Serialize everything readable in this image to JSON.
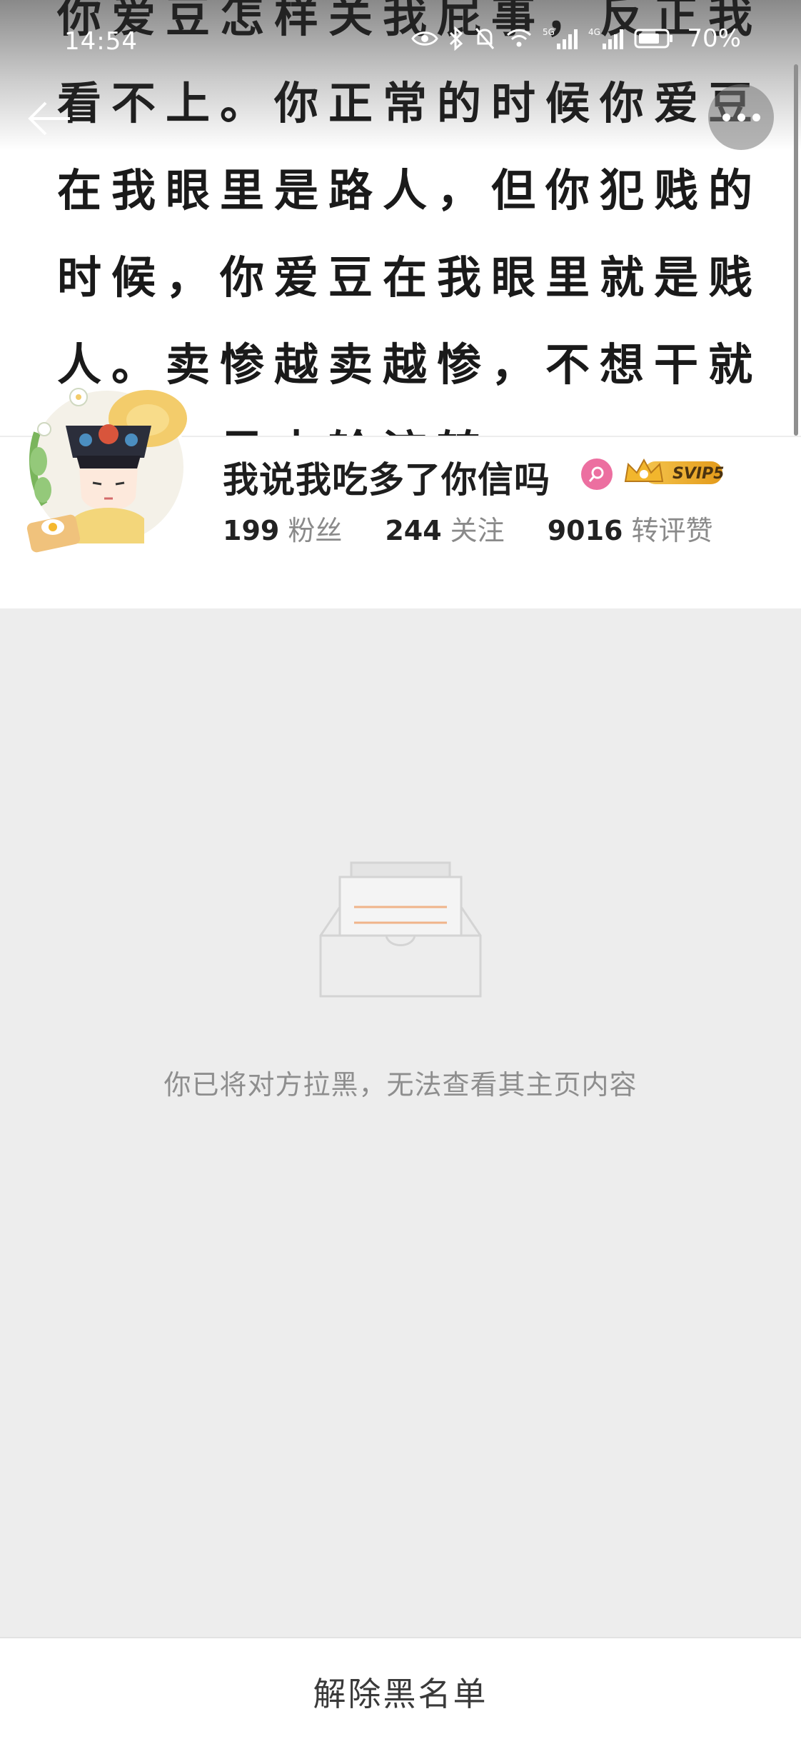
{
  "status_bar": {
    "time": "14:54",
    "battery": "70%",
    "network_labels": [
      "5G",
      "4G"
    ]
  },
  "cover": {
    "lines": [
      "你爱豆怎样关我屁事，反正我",
      "看不上。你正常的时候你爱豆",
      "在我眼里是路人，但你犯贱的",
      "时候，你爱豆在我眼里就是贱",
      "人。卖惨越卖越惨，不想干就",
      "退圈，风水轮流转"
    ]
  },
  "nav": {
    "back_icon": "arrow-left-icon",
    "more_icon": "more-dots-icon"
  },
  "profile": {
    "username": "我说我吃多了你信吗",
    "vip_label": "SVIP5",
    "stats": [
      {
        "value": "199",
        "label": "粉丝"
      },
      {
        "value": "244",
        "label": "关注"
      },
      {
        "value": "9016",
        "label": "转评赞"
      }
    ]
  },
  "empty_state": {
    "message": "你已将对方拉黑，无法查看其主页内容",
    "icon": "empty-inbox-icon"
  },
  "bottom_bar": {
    "unblock_label": "解除黑名单"
  },
  "colors": {
    "page_bg": "#ededed",
    "card_bg": "#ffffff",
    "accent_orange": "#f2a46b",
    "badge_pink": "#ec6fa0",
    "vip_gold": "#e0a626"
  }
}
